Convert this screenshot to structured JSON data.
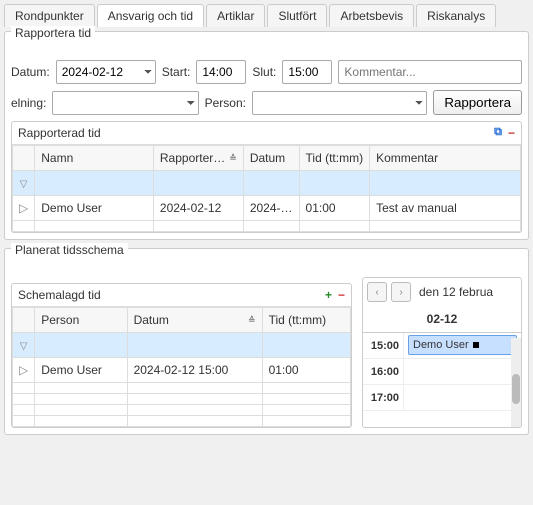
{
  "tabs": {
    "rondpunkter": "Rondpunkter",
    "ansvarig": "Ansvarig och tid",
    "artiklar": "Artiklar",
    "slutfort": "Slutfört",
    "arbetsbevis": "Arbetsbevis",
    "riskanalys": "Riskanalys"
  },
  "report": {
    "panel_title": "Rapportera tid",
    "datum_label": "Datum:",
    "datum_value": "2024-02-12",
    "start_label": "Start:",
    "start_value": "14:00",
    "slut_label": "Slut:",
    "slut_value": "15:00",
    "kommentar_placeholder": "Kommentar...",
    "elning_label": "elning:",
    "person_label": "Person:",
    "rapportera_btn": "Rapportera"
  },
  "reported": {
    "title": "Rapporterad tid",
    "headers": {
      "namn": "Namn",
      "rapporterat": "Rapporter…",
      "datum": "Datum",
      "tid": "Tid (tt:mm)",
      "kommentar": "Kommentar"
    },
    "rows": [
      {
        "namn": "Demo User",
        "rapporterat": "2024-02-12",
        "datum": "2024-…",
        "tid": "01:00",
        "kommentar": "Test av manual"
      }
    ]
  },
  "planned": {
    "panel_title": "Planerat tidsschema",
    "table_title": "Schemalagd tid",
    "headers": {
      "person": "Person",
      "datum": "Datum",
      "tid": "Tid (tt:mm)"
    },
    "rows": [
      {
        "person": "Demo User",
        "datum": "2024-02-12 15:00",
        "tid": "01:00"
      }
    ]
  },
  "calendar": {
    "date_label": "den 12 februa",
    "day_header": "02-12",
    "times": [
      "15:00",
      "16:00",
      "17:00"
    ],
    "event_label": "Demo User"
  }
}
